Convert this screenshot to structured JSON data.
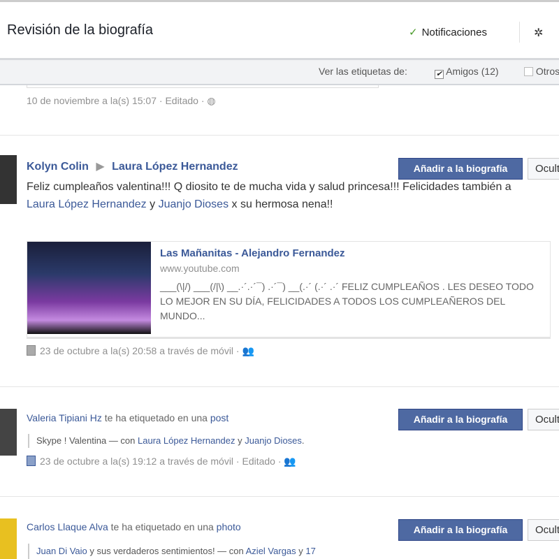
{
  "header": {
    "title": "Revisión de la biografía",
    "notifications": "Notificaciones"
  },
  "filter": {
    "label": "Ver las etiquetas de:",
    "friends": "Amigos (12)",
    "others": "Otros"
  },
  "prev": {
    "meta": "10 de noviembre a la(s) 15:07 · Editado ·"
  },
  "buttons": {
    "add": "Añadir a la biografía",
    "hide": "Ocultar"
  },
  "post1": {
    "author": "Kolyn Colin",
    "target": "Laura López Hernandez",
    "text1": "Feliz cumpleaños valentina!!! Q diosito te de mucha vida y salud princesa!!! Felicidades también a ",
    "mention1": "Laura López Hernandez",
    "and": " y ",
    "mention2": "Juanjo Dioses",
    "text2": " x su hermosa nena!!",
    "link": {
      "title": "Las Mañanitas - Alejandro Fernandez",
      "url": "www.youtube.com",
      "desc": "___(\\|/) ___(/|\\) __.·´.·´¯) .·´¯) __(.·´ (.·´ .·´ FELIZ CUMPLEAÑOS . LES DESEO TODO LO MEJOR EN SU DÍA, FELICIDADES A TODOS LOS CUMPLEAÑEROS DEL MUNDO..."
    },
    "meta": "23 de octubre a la(s) 20:58 a través de móvil ·"
  },
  "post2": {
    "author": "Valeria Tipiani Hz",
    "action": " te ha etiquetado en una ",
    "object": "post",
    "quote_text": "Skype ! Valentina — con ",
    "q1": "Laura López Hernandez",
    "and": " y ",
    "q2": "Juanjo Dioses",
    "end": ".",
    "meta": "23 de octubre a la(s) 19:12 a través de móvil · Editado ·"
  },
  "post3": {
    "author": "Carlos Llaque Alva",
    "action": " te ha etiquetado en una ",
    "object": "photo",
    "q0": "Juan Di Vaio",
    "quote_text": " y sus verdaderos sentimientos! — con ",
    "q1": "Aziel Vargas",
    "and": " y ",
    "q2": "17"
  }
}
